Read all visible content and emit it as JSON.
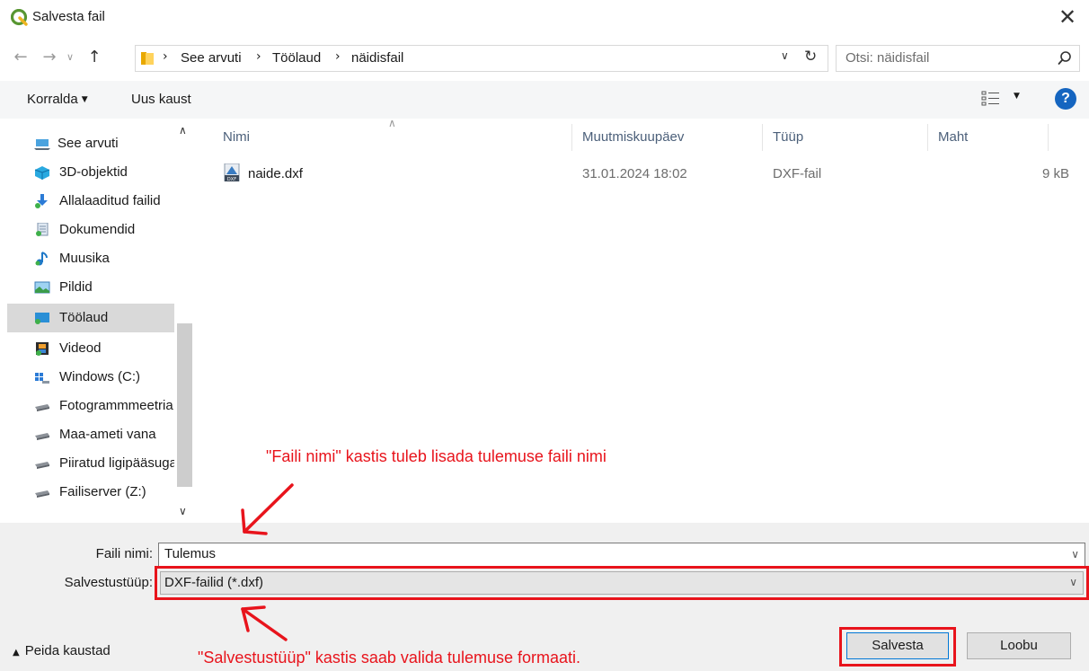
{
  "window": {
    "title": "Salvesta fail",
    "close_glyph": "✕"
  },
  "nav": {
    "breadcrumb": [
      "See arvuti",
      "Töölaud",
      "näidisfail"
    ],
    "search_placeholder": "Otsi: näidisfail"
  },
  "toolbar": {
    "organize_label": "Korralda",
    "new_folder_label": "Uus kaust"
  },
  "sidebar": {
    "items": [
      {
        "label": "See arvuti",
        "icon": "computer-icon"
      },
      {
        "label": "3D-objektid",
        "icon": "3d-objects-icon"
      },
      {
        "label": "Allalaaditud failid",
        "icon": "downloads-icon"
      },
      {
        "label": "Dokumendid",
        "icon": "documents-icon"
      },
      {
        "label": "Muusika",
        "icon": "music-icon"
      },
      {
        "label": "Pildid",
        "icon": "pictures-icon"
      },
      {
        "label": "Töölaud",
        "icon": "desktop-icon",
        "selected": true
      },
      {
        "label": "Videod",
        "icon": "videos-icon"
      },
      {
        "label": "Windows (C:)",
        "icon": "drive-icon"
      },
      {
        "label": "Fotogrammmeetria",
        "icon": "network-drive-icon"
      },
      {
        "label": "Maa-ameti vana",
        "icon": "network-drive-icon"
      },
      {
        "label": "Piiratud ligipääsuga",
        "icon": "network-drive-icon"
      },
      {
        "label": "Failiserver (Z:)",
        "icon": "network-drive-icon"
      }
    ]
  },
  "filelist": {
    "columns": {
      "name": "Nimi",
      "modified": "Muutmiskuupäev",
      "type": "Tüüp",
      "size": "Maht"
    },
    "rows": [
      {
        "name": "naide.dxf",
        "modified": "31.01.2024 18:02",
        "type": "DXF-fail",
        "size": "9 kB"
      }
    ]
  },
  "form": {
    "filename_label": "Faili nimi:",
    "filename_value": "Tulemus",
    "filetype_label": "Salvestustüüp:",
    "filetype_value": "DXF-failid (*.dxf)",
    "hide_folders_label": "Peida kaustad",
    "save_label": "Salvesta",
    "cancel_label": "Loobu"
  },
  "annotations": {
    "top": "\"Faili nimi\" kastis tuleb lisada tulemuse faili nimi",
    "bottom": "\"Salvestustüüp\" kastis saab valida tulemuse formaati."
  },
  "colors": {
    "annotation": "#e8141c",
    "selected": "#d9d9d9",
    "accent": "#0078d7",
    "header_text": "#4c607a"
  }
}
